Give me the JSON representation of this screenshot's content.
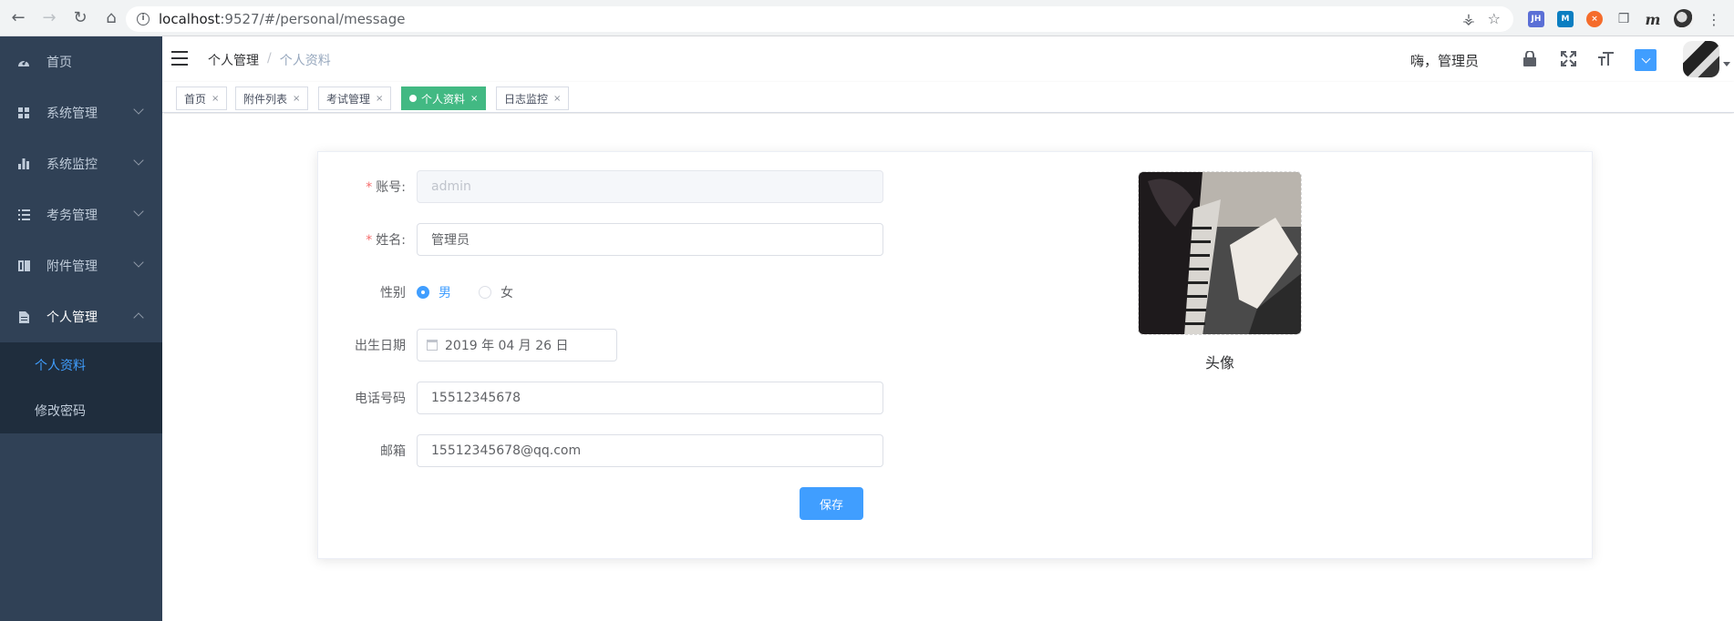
{
  "browser": {
    "url_host": "localhost",
    "url_path": ":9527/#/personal/message"
  },
  "sidebar": {
    "items": [
      {
        "label": "首页",
        "icon": "dashboard-icon"
      },
      {
        "label": "系统管理",
        "icon": "grid-icon"
      },
      {
        "label": "系统监控",
        "icon": "bar-chart-icon"
      },
      {
        "label": "考务管理",
        "icon": "list-icon"
      },
      {
        "label": "附件管理",
        "icon": "book-icon"
      },
      {
        "label": "个人管理",
        "icon": "document-icon"
      }
    ],
    "submenu": [
      {
        "label": "个人资料"
      },
      {
        "label": "修改密码"
      }
    ]
  },
  "navbar": {
    "breadcrumb": [
      "个人管理",
      "个人资料"
    ],
    "greeting": "嗨，管理员"
  },
  "tags": [
    {
      "label": "首页"
    },
    {
      "label": "附件列表"
    },
    {
      "label": "考试管理"
    },
    {
      "label": "个人资料"
    },
    {
      "label": "日志监控"
    }
  ],
  "form": {
    "account_label": "账号:",
    "account_value": "admin",
    "name_label": "姓名:",
    "name_value": "管理员",
    "gender_label": "性别",
    "gender_male": "男",
    "gender_female": "女",
    "birth_label": "出生日期",
    "birth_value": "2019 年 04 月 26 日",
    "phone_label": "电话号码",
    "phone_value": "15512345678",
    "email_label": "邮箱",
    "email_value": "15512345678@qq.com",
    "save_label": "保存",
    "avatar_caption": "头像"
  },
  "colors": {
    "sidebar_bg": "#304156",
    "accent": "#409eff",
    "active_tag": "#42b983"
  }
}
